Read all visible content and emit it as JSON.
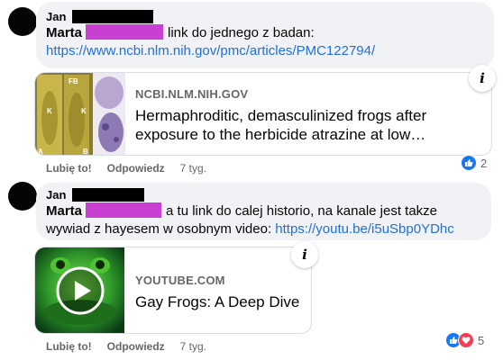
{
  "comments": [
    {
      "author": "Jan",
      "mention": "Marta",
      "text_line1": "link do jednego z badan:",
      "link": "https://www.ncbi.nlm.nih.gov/pmc/articles/PMC122794/",
      "card": {
        "domain": "NCBI.NLM.NIH.GOV",
        "title_line1": "Hermaphroditic, demasculinized frogs after",
        "title_line2": "exposure to the herbicide atrazine at low…",
        "image_labels": [
          "FB",
          "K",
          "K",
          "A",
          "B"
        ]
      },
      "actions": {
        "like": "Lubię to!",
        "reply": "Odpowiedz",
        "time": "7 tyg."
      },
      "reactions": {
        "count": "2"
      }
    },
    {
      "author": "Jan",
      "mention": "Marta",
      "text_line1": "a tu link do calej historio, na kanale jest takze",
      "text_line2": "wywiad z hayesem w osobnym video:",
      "link": "https://youtu.be/i5uSbp0YDhc",
      "card": {
        "domain": "YOUTUBE.COM",
        "title": "Gay Frogs: A Deep Dive"
      },
      "actions": {
        "like": "Lubię to!",
        "reply": "Odpowiedz",
        "time": "7 tyg."
      },
      "reactions": {
        "count": "5"
      }
    }
  ],
  "icons": {
    "info": "i"
  },
  "colors": {
    "link": "#216fdb",
    "mention_highlight": "#c93fd1",
    "bubble": "#f0f2f5",
    "like": "#1877f2",
    "love": "#f33e58"
  }
}
